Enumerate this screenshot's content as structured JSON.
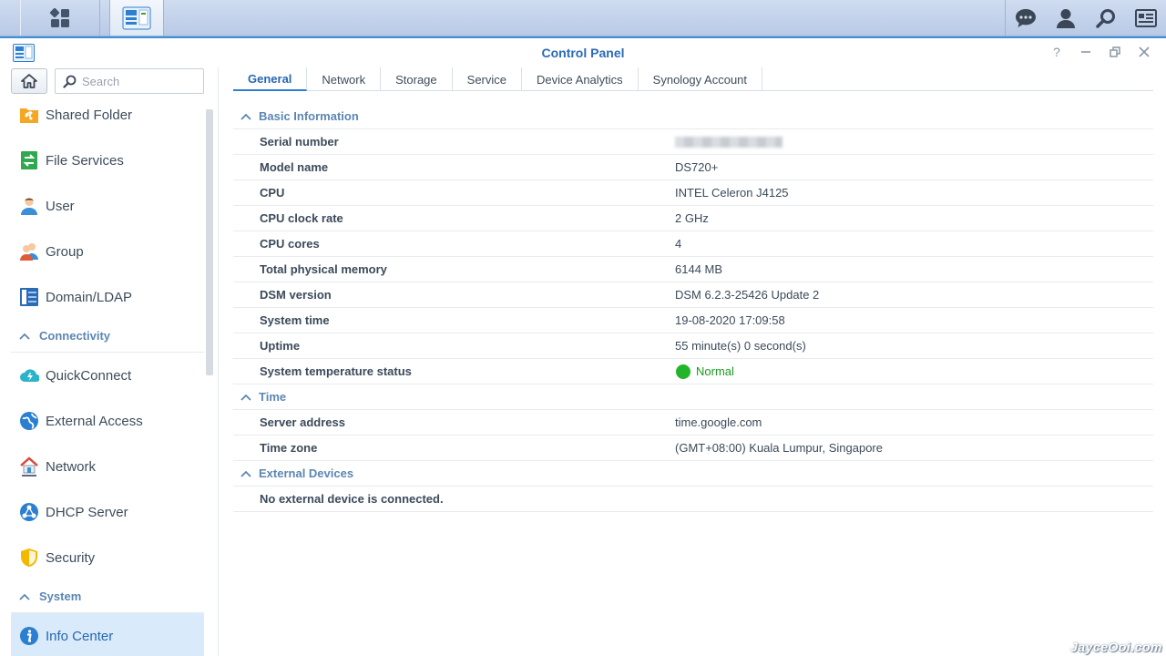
{
  "window": {
    "title": "Control Panel"
  },
  "taskbar": {
    "right_icons": [
      "chat-icon",
      "user-icon",
      "search-icon",
      "widgets-icon"
    ]
  },
  "sidebar": {
    "search_placeholder": "Search",
    "items": [
      {
        "type": "item",
        "label": "Shared Folder",
        "icon": "shared-folder-icon",
        "color": "#f5a623"
      },
      {
        "type": "item",
        "label": "File Services",
        "icon": "file-services-icon",
        "color": "#2fa84f"
      },
      {
        "type": "item",
        "label": "User",
        "icon": "user-icon",
        "color": "#3a8fd8"
      },
      {
        "type": "item",
        "label": "Group",
        "icon": "group-icon",
        "color": "#e05a3a"
      },
      {
        "type": "item",
        "label": "Domain/LDAP",
        "icon": "domain-ldap-icon",
        "color": "#2b6bb5"
      },
      {
        "type": "section",
        "label": "Connectivity"
      },
      {
        "type": "item",
        "label": "QuickConnect",
        "icon": "quickconnect-icon",
        "color": "#2bb3c9"
      },
      {
        "type": "item",
        "label": "External Access",
        "icon": "external-access-icon",
        "color": "#2b7fd0"
      },
      {
        "type": "item",
        "label": "Network",
        "icon": "network-icon",
        "color": "#d94a3a"
      },
      {
        "type": "item",
        "label": "DHCP Server",
        "icon": "dhcp-server-icon",
        "color": "#2b7fd0"
      },
      {
        "type": "item",
        "label": "Security",
        "icon": "security-icon",
        "color": "#f5b800"
      },
      {
        "type": "section",
        "label": "System"
      },
      {
        "type": "item",
        "label": "Info Center",
        "icon": "info-center-icon",
        "color": "#2b7fd0",
        "active": true
      }
    ]
  },
  "tabs": [
    {
      "label": "General",
      "active": true
    },
    {
      "label": "Network"
    },
    {
      "label": "Storage"
    },
    {
      "label": "Service"
    },
    {
      "label": "Device Analytics"
    },
    {
      "label": "Synology Account"
    }
  ],
  "info": {
    "basic": {
      "heading": "Basic Information",
      "serial_label": "Serial number",
      "model_label": "Model name",
      "model": "DS720+",
      "cpu_label": "CPU",
      "cpu": "INTEL Celeron J4125",
      "clock_label": "CPU clock rate",
      "clock": "2 GHz",
      "cores_label": "CPU cores",
      "cores": "4",
      "memory_label": "Total physical memory",
      "memory": "6144 MB",
      "dsm_label": "DSM version",
      "dsm": "DSM 6.2.3-25426 Update 2",
      "time_label": "System time",
      "time": "19-08-2020 17:09:58",
      "uptime_label": "Uptime",
      "uptime": "55 minute(s) 0 second(s)",
      "temp_label": "System temperature status",
      "temp": "Normal"
    },
    "time": {
      "heading": "Time",
      "server_label": "Server address",
      "server": "time.google.com",
      "tz_label": "Time zone",
      "tz": "(GMT+08:00) Kuala Lumpur, Singapore"
    },
    "external": {
      "heading": "External Devices",
      "message": "No external device is connected."
    }
  },
  "watermark": "JayceOoi.com",
  "colors": {
    "accent": "#2b6bb5",
    "status_ok": "#22b52a",
    "section": "#5c86b3"
  }
}
